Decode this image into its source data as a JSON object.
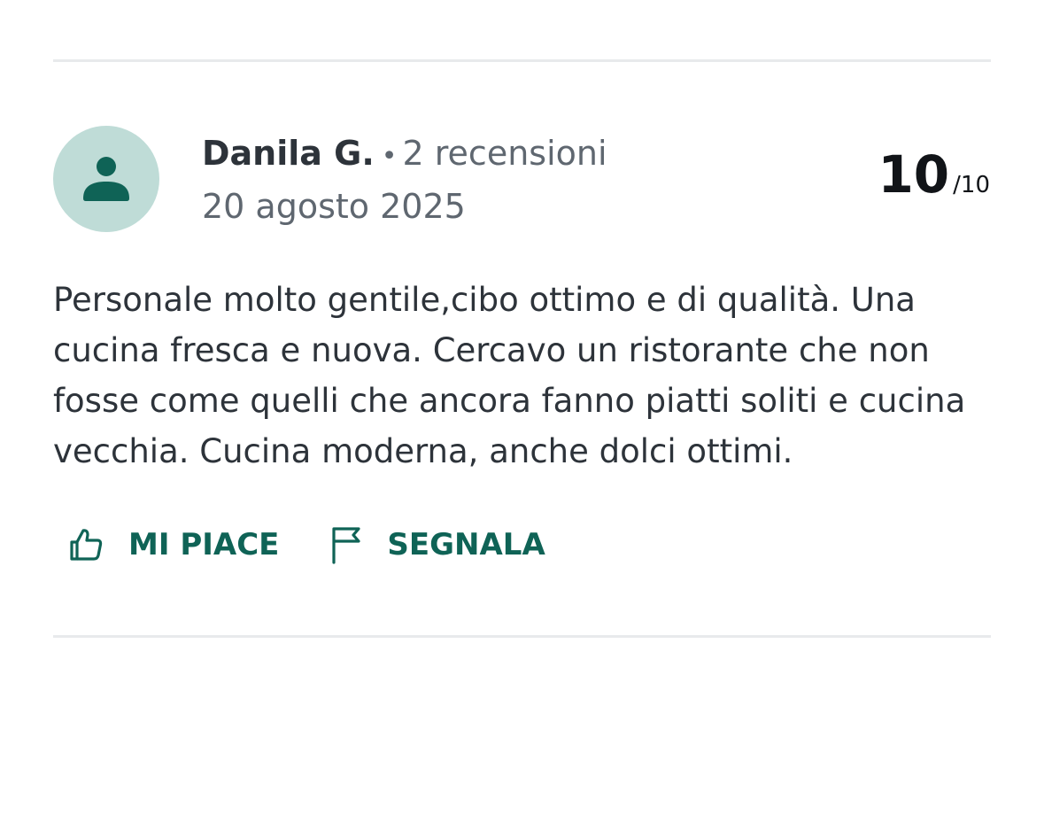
{
  "review": {
    "author": "Danila G.",
    "separator": "•",
    "reviews_count": "2 recensioni",
    "date": "20 agosto 2025",
    "score": "10",
    "score_max": "/10",
    "text": "Personale molto gentile,cibo ottimo e di qualità. Una cucina fresca e nuova. Cercavo un ristorante che non fosse come quelli che ancora fanno piatti soliti e cucina vecchia. Cucina moderna, anche dolci ottimi."
  },
  "actions": {
    "like_label": "MI PIACE",
    "report_label": "SEGNALA"
  },
  "icons": {
    "avatar": "user-icon",
    "like": "thumbs-up-icon",
    "report": "flag-icon"
  },
  "colors": {
    "accent": "#0f6356",
    "avatar_bg": "#bfdcd7",
    "divider": "#e8eaec",
    "text": "#2d333a",
    "muted": "#5f6770"
  }
}
